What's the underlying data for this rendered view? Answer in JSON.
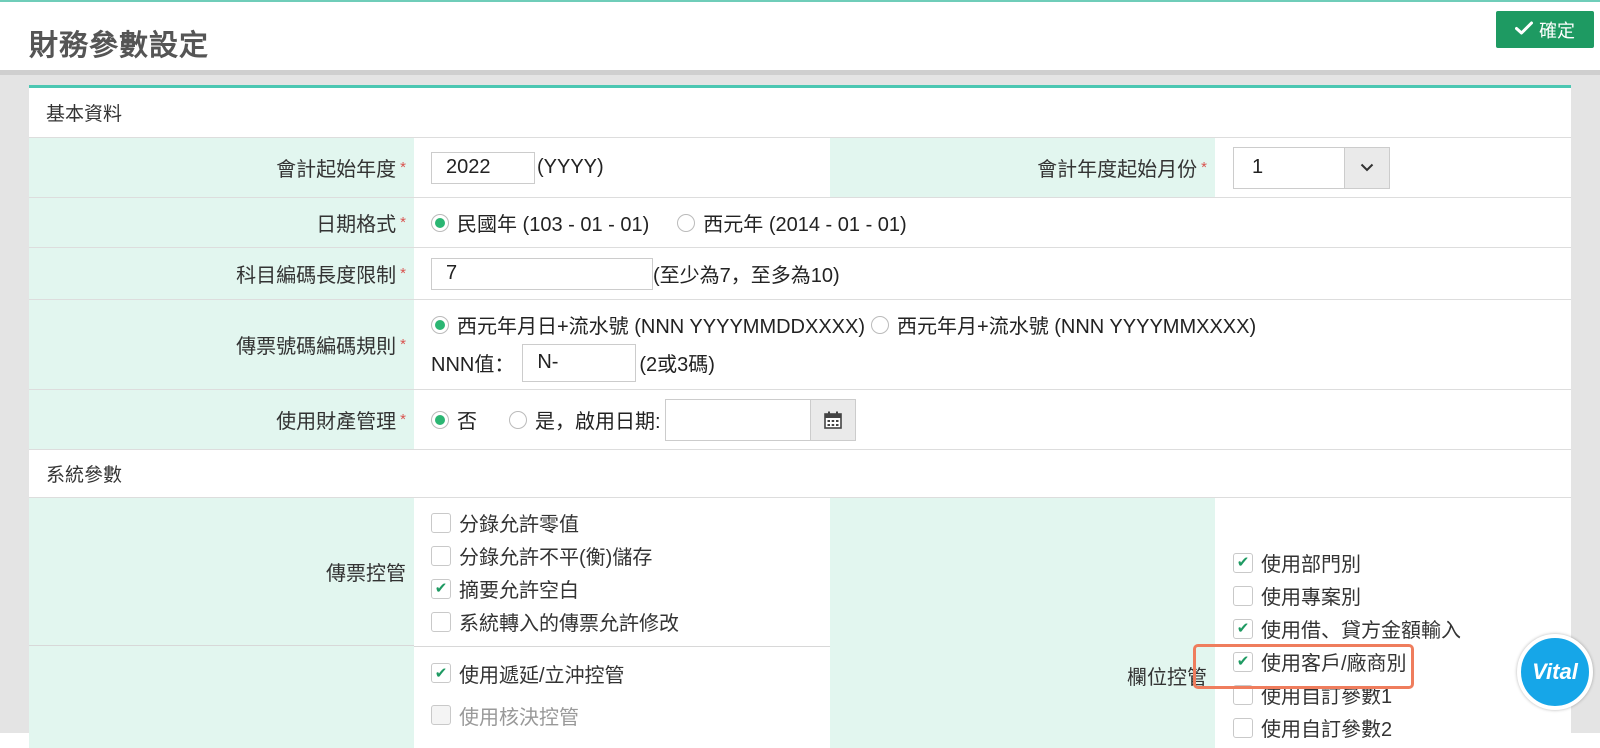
{
  "header": {
    "title": "財務參數設定",
    "confirm_label": "確定"
  },
  "basic": {
    "section_title": "基本資料",
    "fiscal_start_year": {
      "label": "會計起始年度",
      "value": "2022",
      "hint": "(YYYY)"
    },
    "fiscal_start_month": {
      "label": "會計年度起始月份",
      "value": "1"
    },
    "date_format": {
      "label": "日期格式",
      "options": [
        "民國年 (103 - 01 - 01)",
        "西元年 (2014 - 01 - 01)"
      ],
      "selected": 0
    },
    "account_code_length": {
      "label": "科目編碼長度限制",
      "value": "7",
      "hint": "(至少為7，至多為10)"
    },
    "voucher_rule": {
      "label": "傳票號碼編碼規則",
      "options": [
        "西元年月日+流水號 (NNN YYYYMMDDXXXX)",
        "西元年月+流水號 (NNN YYYYMMXXXX)"
      ],
      "selected": 0,
      "nnn_label": "NNN值：",
      "nnn_value": "N-",
      "nnn_hint": "(2或3碼)"
    },
    "asset_mgmt": {
      "label": "使用財產管理",
      "no_label": "否",
      "yes_label": "是，啟用日期:",
      "selected": "no"
    }
  },
  "system": {
    "section_title": "系統參數",
    "voucher_control": {
      "label": "傳票控管",
      "items": [
        {
          "label": "分錄允許零值",
          "checked": false
        },
        {
          "label": "分錄允許不平(衡)儲存",
          "checked": false
        },
        {
          "label": "摘要允許空白",
          "checked": true
        },
        {
          "label": "系統轉入的傳票允許修改",
          "checked": false
        }
      ]
    },
    "other_control": {
      "items": [
        {
          "label": "使用遞延/立沖控管",
          "checked": true
        },
        {
          "label": "使用核決控管",
          "checked": false,
          "disabled": true
        }
      ]
    },
    "field_control": {
      "label": "欄位控管",
      "items": [
        {
          "label": "使用部門別",
          "checked": true
        },
        {
          "label": "使用專案別",
          "checked": false
        },
        {
          "label": "使用借、貸方金額輸入",
          "checked": true
        },
        {
          "label": "使用客戶/廠商別",
          "checked": true
        },
        {
          "label": "使用自訂參數1",
          "checked": false
        },
        {
          "label": "使用自訂參數2",
          "checked": false
        }
      ]
    }
  },
  "colors": {
    "accent": "#1e9a62",
    "label_bg": "#e2f6ef",
    "highlight": "#ef7d5d",
    "radio_on": "#2bb673"
  },
  "badge": {
    "text": "Vital"
  }
}
